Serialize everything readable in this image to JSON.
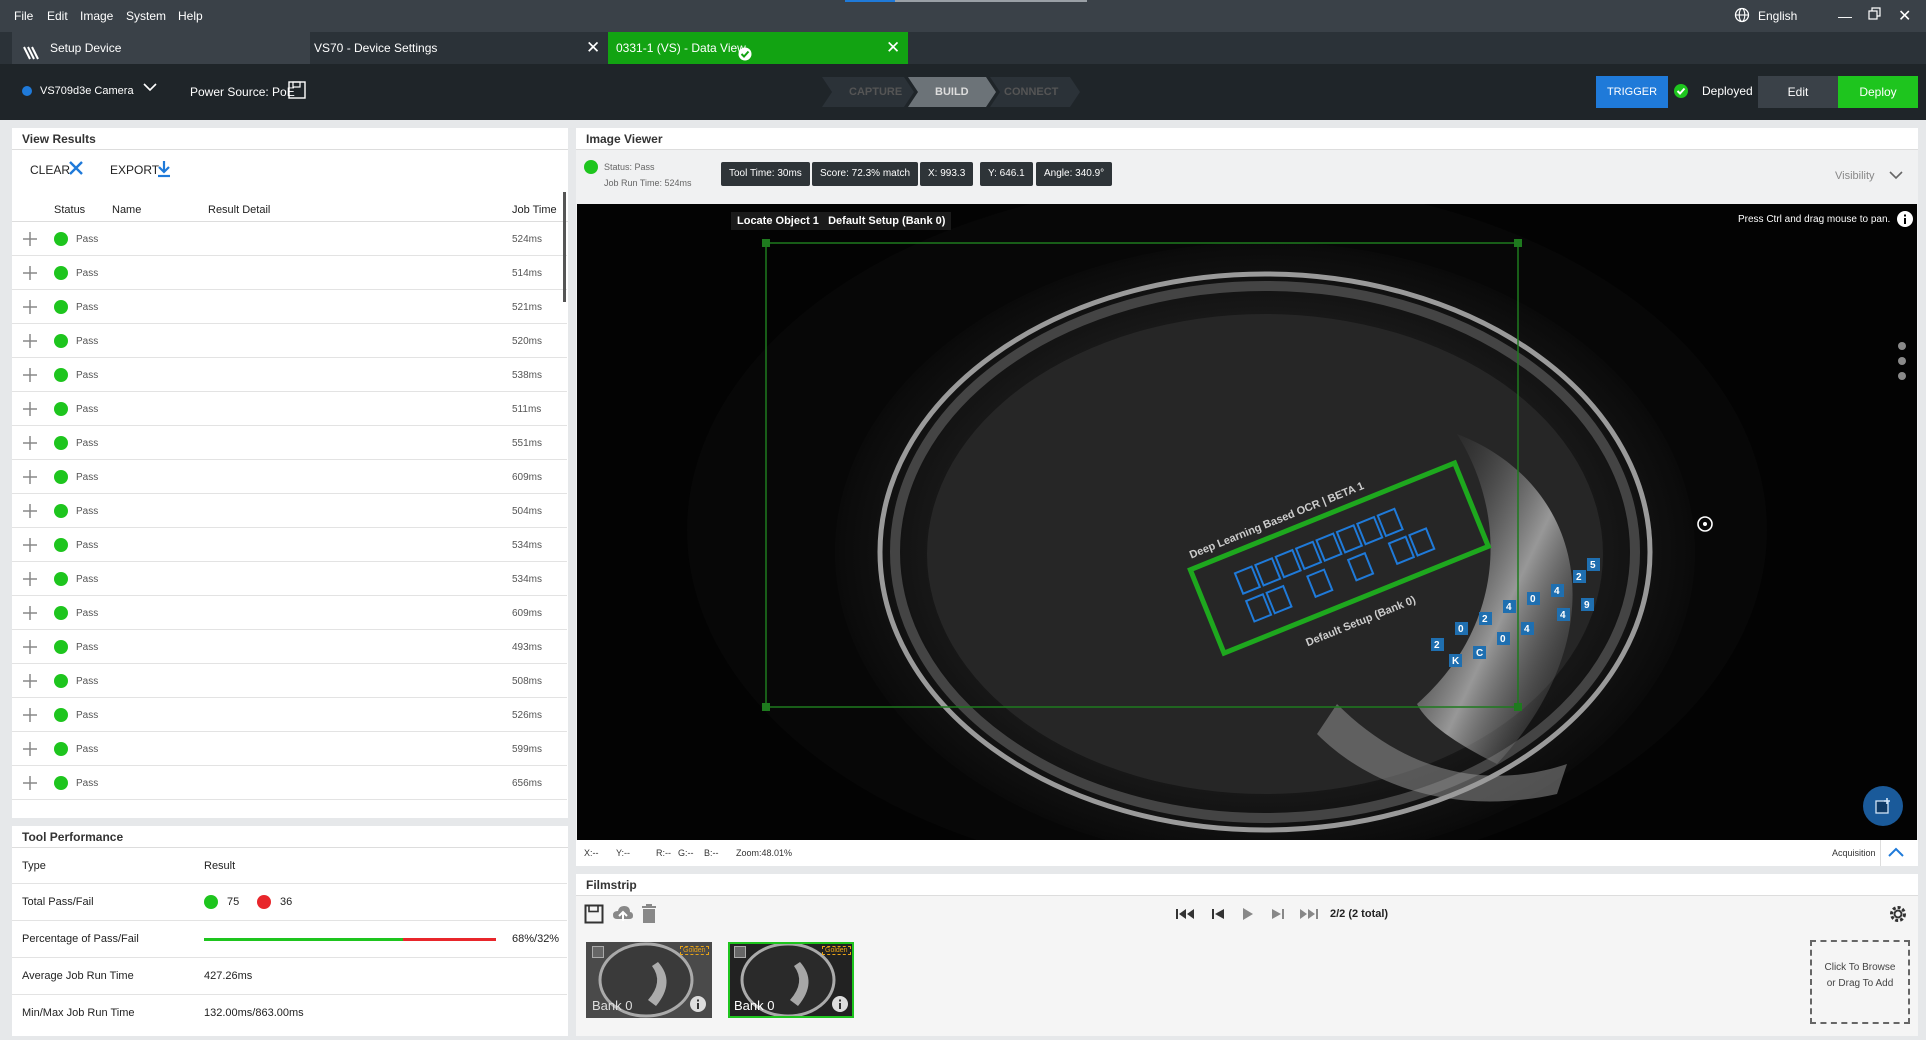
{
  "menu": {
    "file": "File",
    "edit": "Edit",
    "image": "Image",
    "system": "System",
    "help": "Help",
    "language": "English"
  },
  "tabs": {
    "setup": "Setup Device",
    "device_settings": "VS70 - Device Settings",
    "data_view": "0331-1  (VS) - Data View"
  },
  "toolbar": {
    "camera": "VS709d3e Camera",
    "power": "Power Source: PoE",
    "steps": [
      "CAPTURE",
      "BUILD",
      "CONNECT"
    ],
    "trigger": "TRIGGER",
    "deployed": "Deployed",
    "edit": "Edit",
    "deploy": "Deploy"
  },
  "results": {
    "title": "View Results",
    "clear": "CLEAR",
    "export": "EXPORT",
    "columns": {
      "status": "Status",
      "name": "Name",
      "detail": "Result Detail",
      "time": "Job Time"
    },
    "rows": [
      {
        "status": "Pass",
        "time": "524ms"
      },
      {
        "status": "Pass",
        "time": "514ms"
      },
      {
        "status": "Pass",
        "time": "521ms"
      },
      {
        "status": "Pass",
        "time": "520ms"
      },
      {
        "status": "Pass",
        "time": "538ms"
      },
      {
        "status": "Pass",
        "time": "511ms"
      },
      {
        "status": "Pass",
        "time": "551ms"
      },
      {
        "status": "Pass",
        "time": "609ms"
      },
      {
        "status": "Pass",
        "time": "504ms"
      },
      {
        "status": "Pass",
        "time": "534ms"
      },
      {
        "status": "Pass",
        "time": "534ms"
      },
      {
        "status": "Pass",
        "time": "609ms"
      },
      {
        "status": "Pass",
        "time": "493ms"
      },
      {
        "status": "Pass",
        "time": "508ms"
      },
      {
        "status": "Pass",
        "time": "526ms"
      },
      {
        "status": "Pass",
        "time": "599ms"
      },
      {
        "status": "Pass",
        "time": "656ms"
      }
    ]
  },
  "perf": {
    "title": "Tool Performance",
    "type_h": "Type",
    "result_h": "Result",
    "total_label": "Total Pass/Fail",
    "pass_count": "75",
    "fail_count": "36",
    "pct_label": "Percentage of Pass/Fail",
    "pct_value": "68%/32%",
    "pass_fraction": 0.68,
    "avg_label": "Average Job Run Time",
    "avg_value": "427.26ms",
    "minmax_label": "Min/Max Job Run Time",
    "minmax_value": "132.00ms/863.00ms"
  },
  "viewer": {
    "title": "Image Viewer",
    "status": "Status:  Pass",
    "run_time": "Job Run Time:  524ms",
    "tool_time": "Tool Time:  30ms",
    "score": "Score:  72.3% match",
    "x": "X:  993.3",
    "y": "Y:  646.1",
    "angle": "Angle:  340.9°",
    "visibility": "Visibility",
    "hint": "Press Ctrl and drag mouse to pan.",
    "locate": "Locate Object 1",
    "default_setup": "Default Setup (Bank 0)",
    "ocr_label": "Deep Learning Based OCR | BETA 1",
    "bank_label": "Default Setup (Bank 0)",
    "coords": {
      "x": "X:--",
      "y": "Y:--",
      "r": "R:--",
      "g": "G:--",
      "b": "B:--",
      "zoom": "Zoom:48.01%"
    },
    "acquisition": "Acquisition",
    "ocr_chars": [
      "2",
      "0",
      "2",
      "4",
      "0",
      "4",
      "2",
      "5",
      "K",
      "C",
      "0",
      "4",
      "4",
      "9"
    ]
  },
  "filmstrip": {
    "title": "Filmstrip",
    "count": "2/2 (2 total)",
    "golden": "Golden",
    "bank": "Bank 0",
    "add": "Click To Browse or Drag To Add"
  },
  "colors": {
    "accent_green": "#1ec51e",
    "fail_red": "#e8262b",
    "trigger_blue": "#1f7ad9",
    "header_dark": "#1f2529"
  }
}
